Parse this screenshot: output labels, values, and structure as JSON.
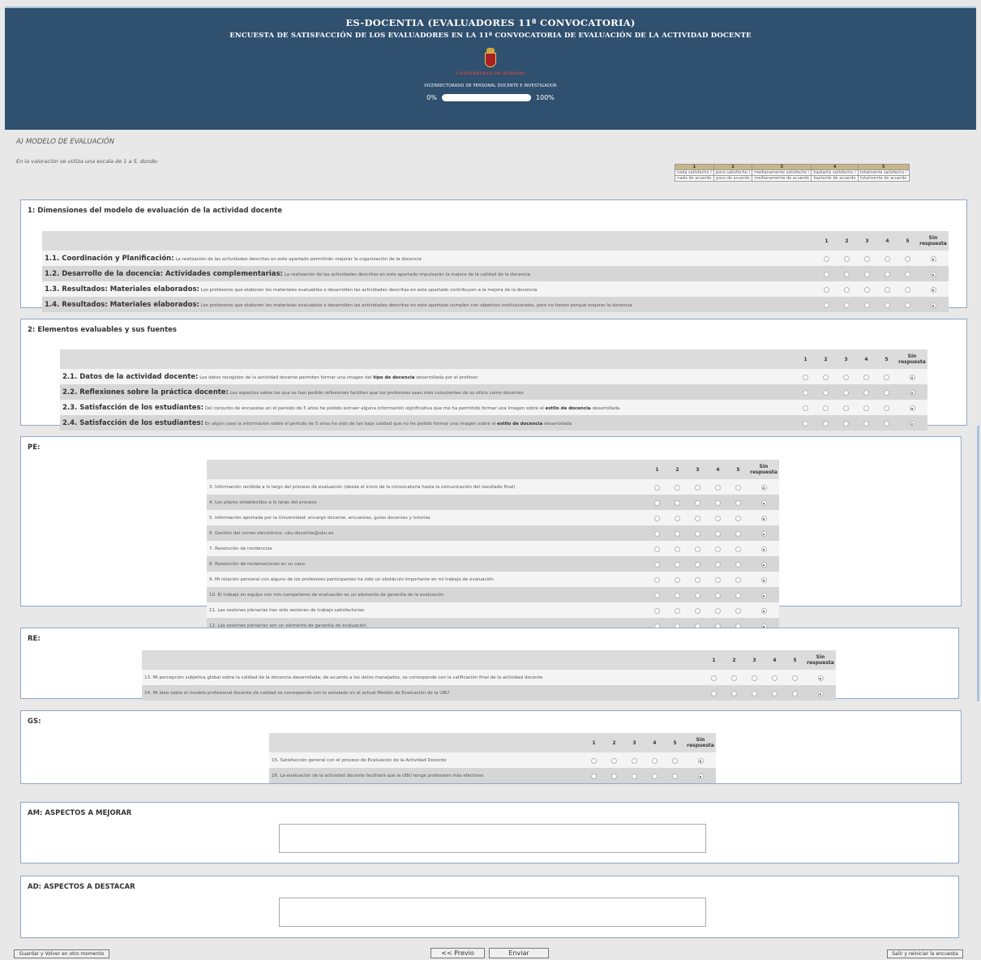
{
  "header": {
    "title": "ES-DOCENTIA (EVALUADORES 11ª CONVOCATORIA)",
    "subtitle": "ENCUESTA DE SATISFACCIÓN DE LOS EVALUADORES EN LA 11ª CONVOCATORIA DE EVALUACIÓN DE LA ACTIVIDAD DOCENTE",
    "university": "UNIVERSIDAD DE BURGOS",
    "vicerrectorado": "VICERRECTORADO DE PERSONAL DOCENTE E INVESTIGADOR",
    "progress_start": "0%",
    "progress_end": "100%",
    "progress_value": 0.0
  },
  "section_a": {
    "title": "A) MODELO DE EVALUACIÓN",
    "scale_note": "En la valoración se utiliza una escala de 1 a 5, donde:"
  },
  "legend": {
    "numbers": [
      "1",
      "2",
      "3",
      "4",
      "5"
    ],
    "line1": [
      "nada satisfecho /",
      "poco satisfecho /",
      "medianamente satisfecho /",
      "bastante satisfecho /",
      "totalmente satisfecho /"
    ],
    "line2": [
      "nada de acuerdo",
      "poco de acuerdo",
      "medianamente de acuerdo",
      "bastante de acuerdo",
      "totalmente de acuerdo"
    ]
  },
  "columns": [
    "1",
    "2",
    "3",
    "4",
    "5"
  ],
  "sin_respuesta": [
    "Sin",
    "respuesta"
  ],
  "block1": {
    "title": "1: Dimensiones del modelo de evaluación de la actividad docente",
    "rows": [
      {
        "label": "1.1. Coordinación y Planificación:",
        "text": "La realización de las actividades descritas en este apartado permitirán mejorar la organización de la docencia"
      },
      {
        "label": "1.2. Desarrollo de la docencia: Actividades complementarias:",
        "text": "La realización de las actividades descritas en este apartado impulsarán la mejora de la calidad de la docencia"
      },
      {
        "label": "1.3. Resultados: Materiales elaborados:",
        "text": "Los profesores que elaboren los materiales evaluables o desarrollen las actividades descritas en este apartado contribuyen a la mejora de la docencia"
      },
      {
        "label": "1.4. Resultados: Materiales elaborados:",
        "text": "Los profesores que elaboren los materiales evaluables o desarrollen las actividades descritas en este apartado cumplen con objetivos institucionales, pero no tienen porqué mejorar la docencia"
      }
    ]
  },
  "block2": {
    "title": "2: Elementos evaluables y sus fuentes",
    "rows": [
      {
        "label": "2.1. Datos de la actividad docente:",
        "pre": "Los datos recogidos de la actividad docente permiten formar una imagen del ",
        "em": "tipo de docencia",
        "post": " desarrollada por el profesor"
      },
      {
        "label": "2.2. Reflexiones sobre la práctica docente:",
        "pre": "Los aspectos sobre los que se han pedido reflexiones facilitan que los profesores sean más conscientes de su oficio como docentes",
        "em": "",
        "post": ""
      },
      {
        "label": "2.3. Satisfacción de los estudiantes:",
        "pre": "Del conjunto de encuestas en el periodo de 5 años he podido extraer alguna información significativa que me ha permitido formar una imagen sobre el ",
        "em": "estilo de docencia",
        "post": " desarrollada"
      },
      {
        "label": "2.4. Satisfacción de los estudiantes:",
        "pre": "En algún caso la información sobre el periodo de 5 años ha sido de tan baja calidad que no he podido formar una imagen sobre el ",
        "em": "estilo de docencia",
        "post": " desarrollada"
      }
    ]
  },
  "block_pe": {
    "title": "PE:",
    "rows": [
      "3. Información recibida a lo largo del proceso de evaluación (desde el inicio de la convocatoria hasta la comunicación del resultado final)",
      "4. Los plazos establecidos a lo largo del proceso",
      "5. Información aportada por la Universidad: encargo docente, encuestas, guías docentes y tutorías",
      "6. Gestión del correo electrónico: ubu-docentia@ubu.es",
      "7. Resolución de incidencias",
      "8. Resolución de reclamaciones en su caso",
      "9. Mi relación personal con alguno de los profesores participantes ha sido un obstáculo importante en mi trabajo de evaluación",
      "10. El trabajo en equipo con mis compañeros de evaluación es un elemento de garantía de la evaluación",
      "11. Las sesiones plenarias han sido sesiones de trabajo satisfactorias",
      "12. Las sesiones plenarias son un elemento de garantía de evaluación"
    ]
  },
  "block_re": {
    "title": "RE:",
    "rows": [
      "13. Mi percepción subjetiva global sobre la calidad de la docencia desarrollada, de acuerdo a los datos manejados, se corresponde con la calificación final de la actividad docente",
      "14. Mi idea sobre el modelo profesional docente de calidad se corresponde con lo señalado en el actual Modelo de Evaluación de la UBU"
    ]
  },
  "block_gs": {
    "title": "GS:",
    "rows": [
      "15. Satisfacción general con el proceso de Evaluación de la Actividad Docente",
      "16. La evaluación de la actividad docente facilitará que la UBU tenga profesores más efectivos"
    ]
  },
  "block_am": {
    "title": "AM: ASPECTOS A MEJORAR",
    "value": ""
  },
  "block_ad": {
    "title": "AD: ASPECTOS A DESTACAR",
    "value": ""
  },
  "buttons": {
    "save": "Guardar y Volver en otro momento",
    "prev": "<< Previo",
    "send": "Enviar",
    "exit": "Salir y reiniciar la encuesta"
  }
}
